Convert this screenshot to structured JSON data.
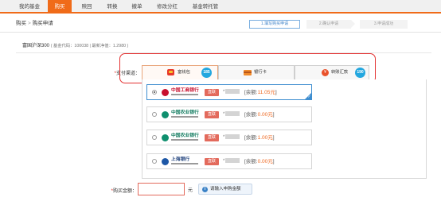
{
  "nav": {
    "items": [
      {
        "label": "我的基金"
      },
      {
        "label": "购买"
      },
      {
        "label": "赎回"
      },
      {
        "label": "转换"
      },
      {
        "label": "撤单"
      },
      {
        "label": "修改分红"
      },
      {
        "label": "基金转托管"
      }
    ],
    "active_index": 1
  },
  "breadcrumb": {
    "section": "购买",
    "separator": ">",
    "page": "购买申请"
  },
  "steps": [
    {
      "label": "1.填写购买申请",
      "active": true
    },
    {
      "label": "2.确认申请",
      "active": false
    },
    {
      "label": "3.申请成功",
      "active": false
    }
  ],
  "fund": {
    "name": "富国沪深300",
    "details": "( 基金代码：100038 | 最新净值：1.2980 )"
  },
  "payment": {
    "required_mark": "*",
    "label": "支付渠道：",
    "tabs": [
      {
        "label": "富钱包",
        "badge": "185",
        "icon": "wallet-icon"
      },
      {
        "label": "银行卡",
        "badge": "",
        "icon": "bank-card-icon"
      },
      {
        "label": "转账汇款",
        "badge": "190",
        "icon": "coin-icon"
      }
    ],
    "banks": [
      {
        "name": "中国工商银行",
        "tag": "直联",
        "card_prefix": "*",
        "balance_prefix": "[余额:",
        "balance": "11.05元",
        "balance_suffix": "]",
        "selected": true,
        "logo_color": "#c8102e",
        "name_color": "#c8102e"
      },
      {
        "name": "中国农业银行",
        "tag": "直联",
        "card_prefix": "*",
        "balance_prefix": "[余额:",
        "balance": "0.00元",
        "balance_suffix": "]",
        "selected": false,
        "logo_color": "#0f8f6e",
        "name_color": "#0f7a5e"
      },
      {
        "name": "中国农业银行",
        "tag": "直联",
        "card_prefix": "*",
        "balance_prefix": "[余额:",
        "balance": "1.00元",
        "balance_suffix": "]",
        "selected": false,
        "logo_color": "#0f8f6e",
        "name_color": "#0f7a5e"
      },
      {
        "name": "上海银行",
        "tag": "直联",
        "card_prefix": "*",
        "balance_prefix": "[余额:",
        "balance": "0.00元",
        "balance_suffix": "]",
        "selected": false,
        "logo_color": "#1d57a6",
        "name_color": "#1d3f7a"
      }
    ]
  },
  "amount": {
    "required_mark": "*",
    "label": "购买金额：",
    "value": "",
    "unit": "元",
    "hint_icon": "i",
    "hint": "请输入申购金额"
  }
}
